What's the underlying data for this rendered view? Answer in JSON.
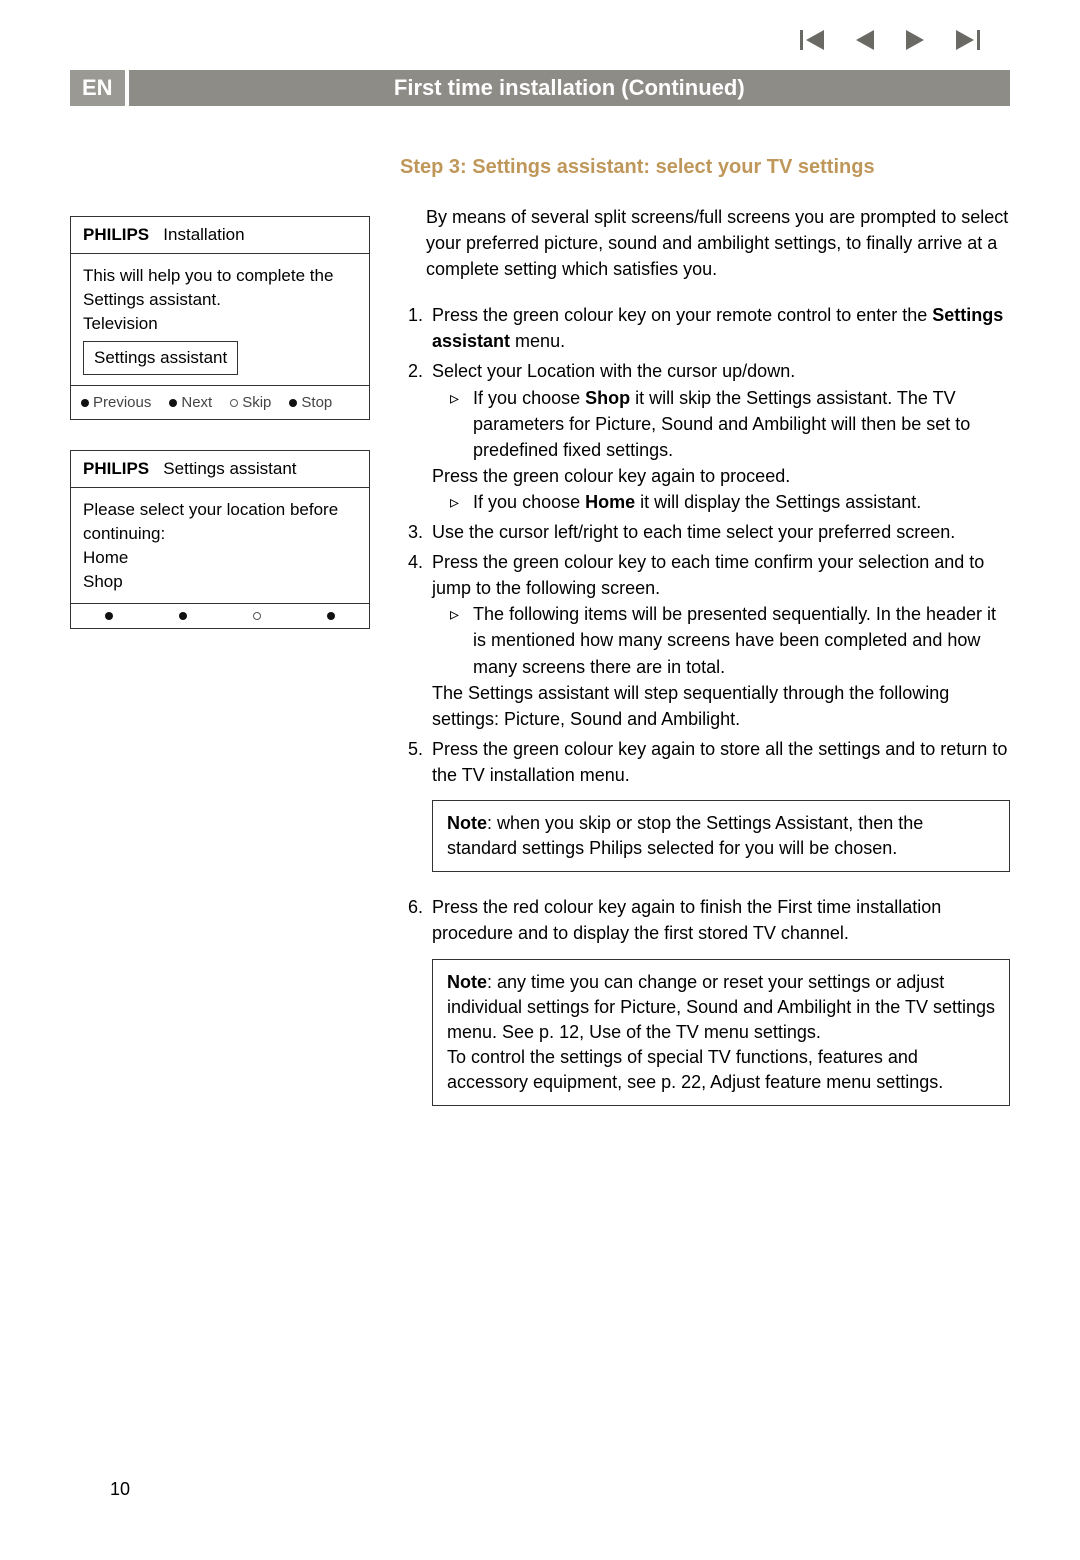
{
  "lang_badge": "EN",
  "page_title": "First time installation  (Continued)",
  "step_heading": "Step 3: Settings assistant: select your TV settings",
  "intro": "By means of several split screens/full screens you are prompted to select your preferred picture, sound and ambilight settings, to finally arrive at a complete setting which satisfies you.",
  "panel1": {
    "brand": "PHILIPS",
    "label": "Installation",
    "body_line1": "This will help you to complete the Settings assistant.",
    "body_line2": "Television",
    "subbox": "Settings assistant",
    "footer": {
      "previous": "Previous",
      "next": "Next",
      "skip": "Skip",
      "stop": "Stop"
    }
  },
  "panel2": {
    "brand": "PHILIPS",
    "label": "Settings assistant",
    "body_line1": "Please select your location before continuing:",
    "opt1": "Home",
    "opt2": "Shop"
  },
  "steps": {
    "s1_a": "Press the green colour key on your remote control to enter the ",
    "s1_b": "Settings assistant",
    "s1_c": " menu.",
    "s2": "Select your Location with the cursor up/down.",
    "s2_shop_a": "If you choose ",
    "s2_shop_b": "Shop",
    "s2_shop_c": " it will skip the Settings assistant. The TV parameters for Picture, Sound and Ambilight will then be set to predefined fixed settings.",
    "s2_proceed": "Press the green colour key again to proceed.",
    "s2_home_a": "If you choose ",
    "s2_home_b": "Home",
    "s2_home_c": " it will display the Settings assistant.",
    "s3": "Use the cursor left/right to each time select your preferred screen.",
    "s4": "Press the green colour key to each time confirm your selection and to jump to the following screen.",
    "s4_seq": "The following items will be presented sequentially. In the header it is mentioned how many screens have been completed and how many screens there are in total.",
    "s4_cont": "The Settings assistant will step sequentially through the following settings: Picture, Sound and Ambilight.",
    "s5": "Press the green colour key again to store all the settings and to return to the TV installation menu.",
    "note1_a": "Note",
    "note1_b": ": when you skip or stop the Settings Assistant, then the standard settings Philips selected for you will be chosen.",
    "s6": "Press the red colour key again to finish the First time installation procedure and to display the first stored TV channel.",
    "note2_a": "Note",
    "note2_b": ": any time you can change or reset your settings or adjust individual settings for Picture, Sound and Ambilight in the TV settings menu. See p. 12, Use of the TV menu settings.",
    "note2_c": "To control the settings of special TV functions, features and accessory equipment, see p. 22,  Adjust feature menu settings."
  },
  "page_number": "10"
}
